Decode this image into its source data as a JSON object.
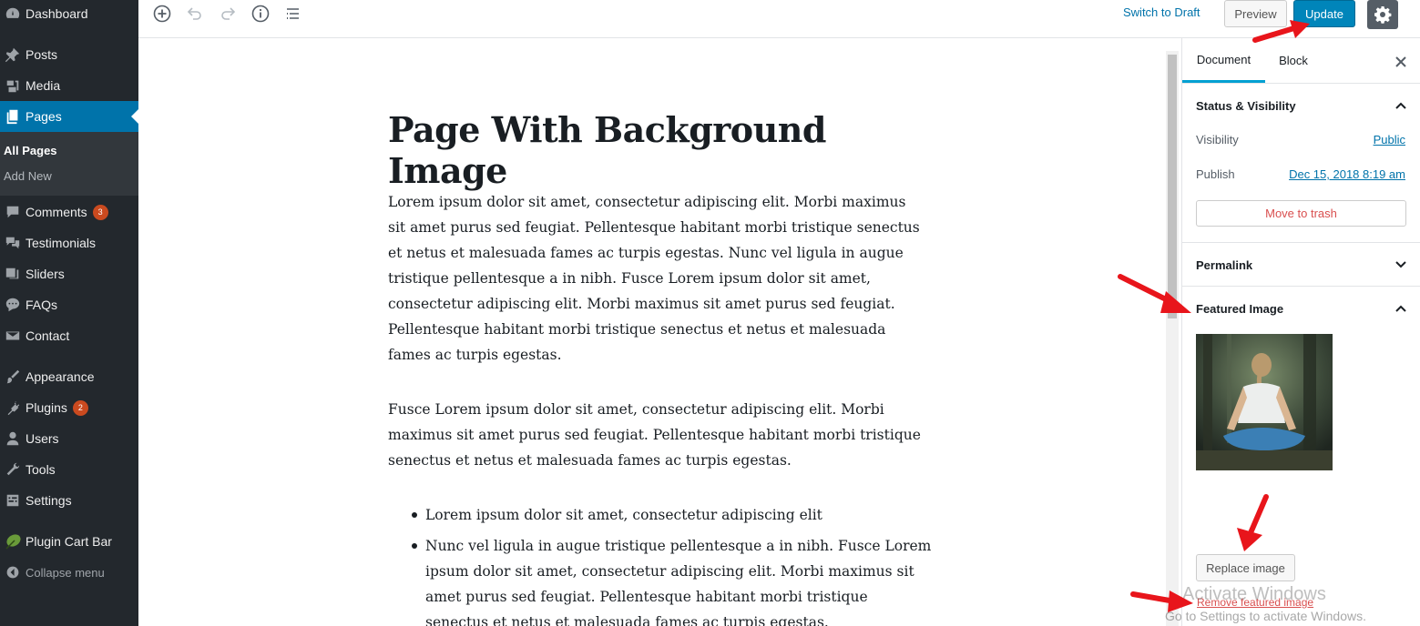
{
  "admin_menu": {
    "items": [
      {
        "label": "Dashboard",
        "icon": "dashboard-icon"
      },
      {
        "label": "Posts",
        "icon": "pin-icon"
      },
      {
        "label": "Media",
        "icon": "media-icon"
      },
      {
        "label": "Pages",
        "icon": "pages-icon"
      },
      {
        "label": "Comments",
        "icon": "comment-icon",
        "badge": "3"
      },
      {
        "label": "Testimonials",
        "icon": "testimonials-icon"
      },
      {
        "label": "Sliders",
        "icon": "sliders-icon"
      },
      {
        "label": "FAQs",
        "icon": "faq-icon"
      },
      {
        "label": "Contact",
        "icon": "mail-icon"
      },
      {
        "label": "Appearance",
        "icon": "brush-icon"
      },
      {
        "label": "Plugins",
        "icon": "plug-icon",
        "badge": "2"
      },
      {
        "label": "Users",
        "icon": "user-icon"
      },
      {
        "label": "Tools",
        "icon": "wrench-icon"
      },
      {
        "label": "Settings",
        "icon": "settings-icon"
      },
      {
        "label": "Plugin Cart Bar",
        "icon": "leaf-icon"
      }
    ],
    "submenu": [
      "All Pages",
      "Add New"
    ],
    "collapse_label": "Collapse menu",
    "active_color": "#0073aa",
    "background_color": "#23282d"
  },
  "toolbar": {
    "switch_to_draft": "Switch to Draft",
    "preview": "Preview",
    "update": "Update",
    "accent_color": "#0085ba"
  },
  "editor": {
    "title": "Page With Background Image",
    "paragraph_1": "Lorem ipsum dolor sit amet, consectetur adipiscing elit. Morbi maximus sit amet purus sed feugiat. Pellentesque habitant morbi tristique senectus et netus et malesuada fames ac turpis egestas. Nunc vel ligula in augue tristique pellentesque a in nibh. Fusce Lorem ipsum dolor sit amet, consectetur adipiscing elit. Morbi maximus sit amet purus sed feugiat. Pellentesque habitant morbi tristique senectus et netus et malesuada fames ac turpis egestas.",
    "paragraph_2": "Fusce Lorem ipsum dolor sit amet, consectetur adipiscing elit. Morbi maximus sit amet purus sed feugiat. Pellentesque habitant morbi tristique senectus et netus et malesuada fames ac turpis egestas.",
    "bullets": [
      "Lorem ipsum dolor sit amet, consectetur adipiscing elit",
      "Nunc vel ligula in augue tristique pellentesque a in nibh. Fusce Lorem ipsum dolor sit amet, consectetur adipiscing elit. Morbi maximus sit amet purus sed feugiat. Pellentesque habitant morbi tristique senectus et netus et malesuada fames ac turpis egestas."
    ]
  },
  "sidebar": {
    "tab_document": "Document",
    "tab_block": "Block",
    "status_visibility": {
      "title": "Status & Visibility",
      "visibility_label": "Visibility",
      "visibility_value": "Public",
      "publish_label": "Publish",
      "publish_value": "Dec 15, 2018 8:19 am",
      "trash": "Move to trash"
    },
    "permalink_title": "Permalink",
    "featured_image": {
      "title": "Featured Image",
      "replace": "Replace image",
      "remove": "Remove featured image"
    }
  },
  "watermark": {
    "line1": "Activate Windows",
    "line2": "Go to Settings to activate Windows."
  },
  "annotation_color": "#e8151b"
}
